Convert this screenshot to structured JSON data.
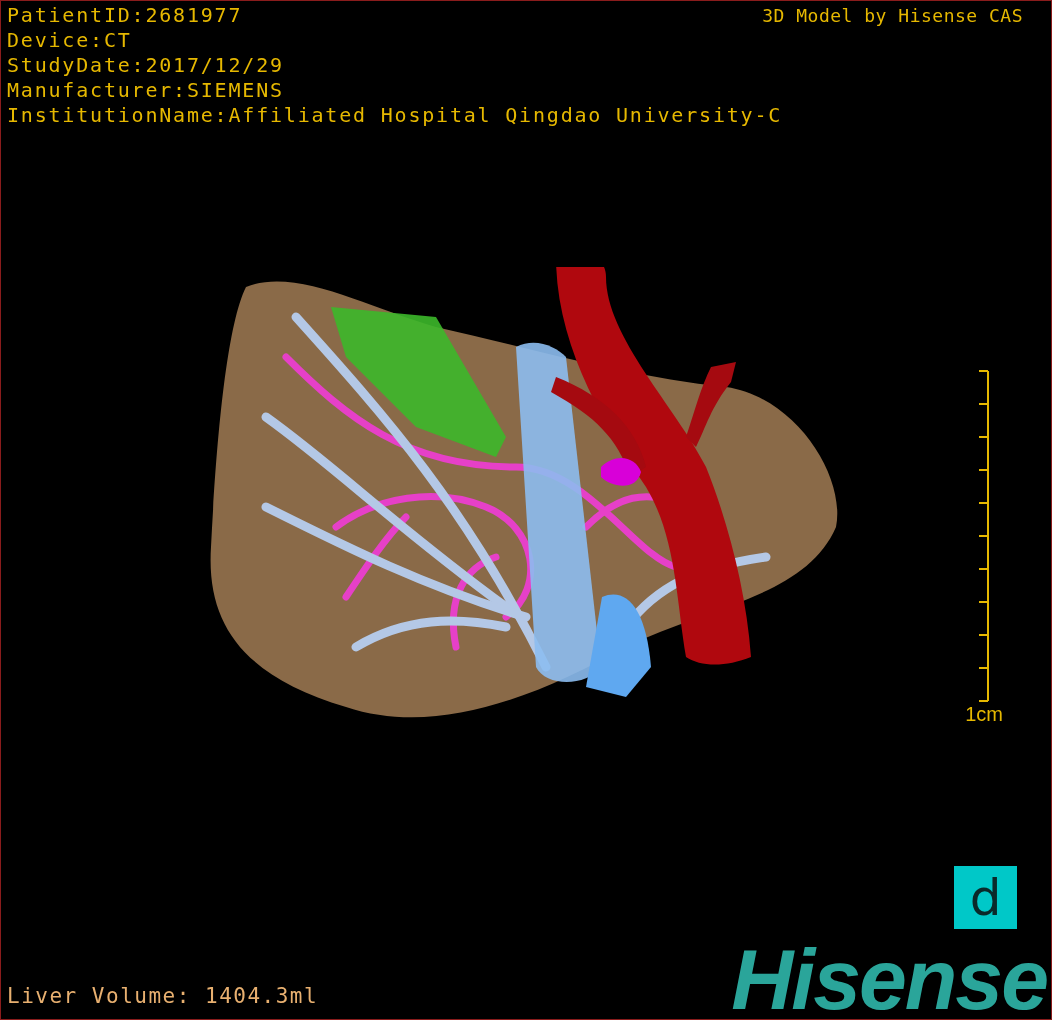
{
  "viewer": {
    "info_lines": [
      "PatientID:2681977",
      "Device:CT",
      "StudyDate:2017/12/29",
      "Manufacturer:SIEMENS",
      "InstitutionName:Affiliated Hospital Qingdao University-C"
    ],
    "title": "3D Model by Hisense CAS",
    "scale_bar": {
      "label": "1cm"
    },
    "volume": "Liver Volume: 1404.3ml",
    "badge": "d",
    "brand": "Hisense"
  }
}
